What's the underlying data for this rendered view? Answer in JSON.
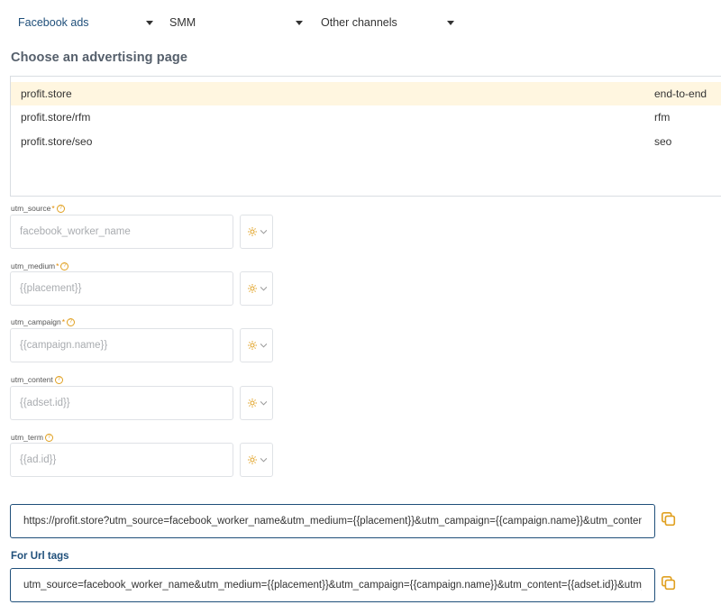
{
  "tabs": [
    {
      "label": "Facebook ads",
      "active": true
    },
    {
      "label": "SMM",
      "active": false
    },
    {
      "label": "Other channels",
      "active": false
    }
  ],
  "heading": "Choose an advertising page",
  "pages": [
    {
      "url": "profit.store",
      "tag": "end-to-end",
      "selected": true
    },
    {
      "url": "profit.store/rfm",
      "tag": "rfm",
      "selected": false
    },
    {
      "url": "profit.store/seo",
      "tag": "seo",
      "selected": false
    }
  ],
  "fields": [
    {
      "label": "utm_source",
      "required": true,
      "placeholder": "facebook_worker_name"
    },
    {
      "label": "utm_medium",
      "required": true,
      "placeholder": "{{placement}}"
    },
    {
      "label": "utm_campaign",
      "required": true,
      "placeholder": "{{campaign.name}}"
    },
    {
      "label": "utm_content",
      "required": false,
      "placeholder": "{{adset.id}}"
    },
    {
      "label": "utm_term",
      "required": false,
      "placeholder": "{{ad.id}}"
    }
  ],
  "required_mark": "*",
  "help_mark": "?",
  "icons": {
    "settings": "gear-icon",
    "dropdown": "chevron-down-icon",
    "copy": "copy-icon"
  },
  "colors": {
    "accent": "#1f4f7a",
    "warning": "#e0a020",
    "selected_row": "#fff6e0"
  },
  "full_url": "https://profit.store?utm_source=facebook_worker_name&utm_medium={{placement}}&utm_campaign={{campaign.name}}&utm_content={{adset.id}}&utm_term={{ad.id}}",
  "url_tags_label": "For Url tags",
  "url_tags": "utm_source=facebook_worker_name&utm_medium={{placement}}&utm_campaign={{campaign.name}}&utm_content={{adset.id}}&utm_term={{ad.id}}"
}
